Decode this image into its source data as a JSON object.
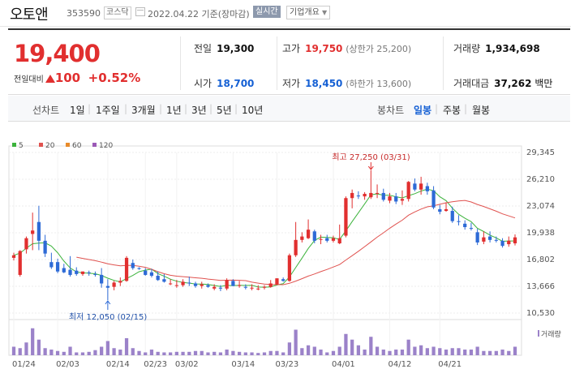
{
  "header": {
    "name": "오토앤",
    "code": "353590",
    "market": "코스닥",
    "date": "2022.04.22 기준(장마감)",
    "realtime": "실시간",
    "corp_overview": "기업개요"
  },
  "quote": {
    "price": "19,400",
    "change_label": "전일대비",
    "change": "100",
    "change_pct": "+0.52%",
    "rows": [
      {
        "label": "전일",
        "value": "19,300"
      },
      {
        "label": "고가",
        "value": "19,750",
        "sub": "(상한가 25,200)"
      },
      {
        "label": "거래량",
        "value": "1,934,698"
      },
      {
        "label": "시가",
        "value": "18,700"
      },
      {
        "label": "저가",
        "value": "18,450",
        "sub": "(하한가 13,600)"
      },
      {
        "label": "거래대금",
        "value": "37,262",
        "unit": "백만"
      }
    ]
  },
  "tabs": {
    "line_label": "선차트",
    "line_items": [
      "1일",
      "1주일",
      "3개월",
      "1년",
      "3년",
      "5년",
      "10년"
    ],
    "candle_label": "봉차트",
    "candle_items": [
      "일봉",
      "주봉",
      "월봉"
    ]
  },
  "chart_data": {
    "type": "candlestick",
    "legend": [
      "5",
      "20",
      "60",
      "120"
    ],
    "legend_colors": [
      "#3cb33c",
      "#e0524f",
      "#e88b2a",
      "#9b59b6"
    ],
    "y_ticks": [
      "29,345",
      "26,210",
      "23,074",
      "19,938",
      "16,802",
      "13,666",
      "10,530"
    ],
    "y_range": [
      10530,
      29345
    ],
    "x_labels": [
      "01/24",
      "02/03",
      "02/14",
      "02/23",
      "03/02",
      "03/14",
      "03/23",
      "04/01",
      "04/12",
      "04/21"
    ],
    "high_annotation": "최고 27,250 (03/31)",
    "low_annotation": "최저 12,050 (02/15)",
    "volume_label": "거래량",
    "candles": [
      {
        "o": 17000,
        "h": 17600,
        "l": 16700,
        "c": 17300
      },
      {
        "o": 15000,
        "h": 17900,
        "l": 14800,
        "c": 17800
      },
      {
        "o": 18000,
        "h": 19500,
        "l": 17500,
        "c": 19300
      },
      {
        "o": 19800,
        "h": 22300,
        "l": 17900,
        "c": 20200
      },
      {
        "o": 21200,
        "h": 23100,
        "l": 17900,
        "c": 19000
      },
      {
        "o": 19000,
        "h": 19700,
        "l": 17100,
        "c": 17500
      },
      {
        "o": 16500,
        "h": 17600,
        "l": 15700,
        "c": 15900
      },
      {
        "o": 16500,
        "h": 16900,
        "l": 15200,
        "c": 15400
      },
      {
        "o": 15800,
        "h": 16300,
        "l": 15200,
        "c": 15300
      },
      {
        "o": 15600,
        "h": 17200,
        "l": 14800,
        "c": 15000
      },
      {
        "o": 15500,
        "h": 15900,
        "l": 14900,
        "c": 15100
      },
      {
        "o": 15100,
        "h": 15400,
        "l": 14900,
        "c": 15400
      },
      {
        "o": 15300,
        "h": 15500,
        "l": 14900,
        "c": 15200
      },
      {
        "o": 15100,
        "h": 15400,
        "l": 14800,
        "c": 15000
      },
      {
        "o": 15000,
        "h": 15800,
        "l": 13500,
        "c": 14000
      },
      {
        "o": 13700,
        "h": 14500,
        "l": 12050,
        "c": 13500
      },
      {
        "o": 13600,
        "h": 14300,
        "l": 13200,
        "c": 14100
      },
      {
        "o": 14100,
        "h": 14700,
        "l": 13700,
        "c": 14300
      },
      {
        "o": 14300,
        "h": 17200,
        "l": 14200,
        "c": 17000
      },
      {
        "o": 16400,
        "h": 16800,
        "l": 15600,
        "c": 15800
      },
      {
        "o": 15800,
        "h": 15900,
        "l": 15600,
        "c": 15700
      },
      {
        "o": 15500,
        "h": 15800,
        "l": 14900,
        "c": 15000
      },
      {
        "o": 15300,
        "h": 15700,
        "l": 14700,
        "c": 14900
      },
      {
        "o": 14900,
        "h": 15400,
        "l": 14300,
        "c": 14400
      },
      {
        "o": 14500,
        "h": 15100,
        "l": 14100,
        "c": 14200
      },
      {
        "o": 14000,
        "h": 14500,
        "l": 13800,
        "c": 14000
      },
      {
        "o": 13800,
        "h": 14400,
        "l": 13500,
        "c": 13800
      },
      {
        "o": 13800,
        "h": 14500,
        "l": 13600,
        "c": 14200
      },
      {
        "o": 14100,
        "h": 14800,
        "l": 13700,
        "c": 14000
      },
      {
        "o": 14000,
        "h": 14200,
        "l": 13500,
        "c": 13700
      },
      {
        "o": 13700,
        "h": 14200,
        "l": 13400,
        "c": 13900
      },
      {
        "o": 13800,
        "h": 14000,
        "l": 13500,
        "c": 13600
      },
      {
        "o": 13400,
        "h": 13900,
        "l": 13200,
        "c": 13600
      },
      {
        "o": 13500,
        "h": 13800,
        "l": 13100,
        "c": 13400
      },
      {
        "o": 13400,
        "h": 14600,
        "l": 13200,
        "c": 14400
      },
      {
        "o": 14300,
        "h": 14500,
        "l": 13700,
        "c": 13700
      },
      {
        "o": 13800,
        "h": 14300,
        "l": 13500,
        "c": 13800
      },
      {
        "o": 13600,
        "h": 13900,
        "l": 13300,
        "c": 13500
      },
      {
        "o": 13500,
        "h": 13900,
        "l": 13200,
        "c": 13500
      },
      {
        "o": 13400,
        "h": 13800,
        "l": 13200,
        "c": 13400
      },
      {
        "o": 13500,
        "h": 13800,
        "l": 13300,
        "c": 13600
      },
      {
        "o": 13600,
        "h": 14400,
        "l": 13500,
        "c": 14000
      },
      {
        "o": 13900,
        "h": 14600,
        "l": 13800,
        "c": 14600
      },
      {
        "o": 14500,
        "h": 14700,
        "l": 14200,
        "c": 14300
      },
      {
        "o": 14300,
        "h": 17500,
        "l": 14200,
        "c": 17300
      },
      {
        "o": 17300,
        "h": 21200,
        "l": 17100,
        "c": 19100
      },
      {
        "o": 19100,
        "h": 20000,
        "l": 18800,
        "c": 19500
      },
      {
        "o": 19300,
        "h": 21500,
        "l": 19200,
        "c": 20300
      },
      {
        "o": 20100,
        "h": 20300,
        "l": 18700,
        "c": 19000
      },
      {
        "o": 19200,
        "h": 19700,
        "l": 18600,
        "c": 19200
      },
      {
        "o": 19300,
        "h": 19700,
        "l": 18800,
        "c": 19000
      },
      {
        "o": 19000,
        "h": 19600,
        "l": 18800,
        "c": 19300
      },
      {
        "o": 18700,
        "h": 20900,
        "l": 18600,
        "c": 19300
      },
      {
        "o": 19600,
        "h": 24200,
        "l": 19400,
        "c": 24000
      },
      {
        "o": 24000,
        "h": 25000,
        "l": 22800,
        "c": 24600
      },
      {
        "o": 24300,
        "h": 24800,
        "l": 23900,
        "c": 24200
      },
      {
        "o": 24200,
        "h": 24700,
        "l": 23800,
        "c": 24500
      },
      {
        "o": 24100,
        "h": 27250,
        "l": 23900,
        "c": 24600
      },
      {
        "o": 24600,
        "h": 25600,
        "l": 24000,
        "c": 24600
      },
      {
        "o": 24600,
        "h": 25100,
        "l": 23600,
        "c": 23800
      },
      {
        "o": 23700,
        "h": 24600,
        "l": 23400,
        "c": 24200
      },
      {
        "o": 24200,
        "h": 24600,
        "l": 23300,
        "c": 23600
      },
      {
        "o": 23700,
        "h": 24900,
        "l": 23200,
        "c": 23900
      },
      {
        "o": 23900,
        "h": 26000,
        "l": 23600,
        "c": 25900
      },
      {
        "o": 25700,
        "h": 26300,
        "l": 24800,
        "c": 25000
      },
      {
        "o": 25000,
        "h": 26500,
        "l": 24400,
        "c": 25700
      },
      {
        "o": 25400,
        "h": 25800,
        "l": 24400,
        "c": 24800
      },
      {
        "o": 24900,
        "h": 25400,
        "l": 22700,
        "c": 22900
      },
      {
        "o": 22700,
        "h": 23200,
        "l": 22100,
        "c": 22400
      },
      {
        "o": 22500,
        "h": 23500,
        "l": 22400,
        "c": 22700
      },
      {
        "o": 22500,
        "h": 23000,
        "l": 21100,
        "c": 21300
      },
      {
        "o": 21300,
        "h": 22000,
        "l": 20800,
        "c": 21200
      },
      {
        "o": 21000,
        "h": 21400,
        "l": 20300,
        "c": 20600
      },
      {
        "o": 20500,
        "h": 21100,
        "l": 20200,
        "c": 20400
      },
      {
        "o": 20000,
        "h": 20400,
        "l": 18500,
        "c": 18800
      },
      {
        "o": 18900,
        "h": 20100,
        "l": 18600,
        "c": 19400
      },
      {
        "o": 19500,
        "h": 20100,
        "l": 18800,
        "c": 19100
      },
      {
        "o": 19100,
        "h": 19500,
        "l": 18800,
        "c": 19000
      },
      {
        "o": 19000,
        "h": 19300,
        "l": 18200,
        "c": 18400
      },
      {
        "o": 18600,
        "h": 19500,
        "l": 18300,
        "c": 19000
      },
      {
        "o": 18700,
        "h": 19750,
        "l": 18450,
        "c": 19400
      }
    ],
    "volume": [
      0.3,
      0.25,
      0.45,
      0.95,
      0.55,
      0.25,
      0.2,
      0.15,
      0.12,
      0.3,
      0.1,
      0.1,
      0.12,
      0.18,
      0.3,
      0.5,
      0.25,
      0.2,
      0.6,
      0.25,
      0.15,
      0.1,
      0.2,
      0.12,
      0.1,
      0.1,
      0.12,
      0.12,
      0.12,
      0.15,
      0.15,
      0.1,
      0.12,
      0.1,
      0.2,
      0.15,
      0.12,
      0.1,
      0.1,
      0.08,
      0.1,
      0.15,
      0.15,
      0.1,
      0.45,
      0.9,
      0.25,
      0.35,
      0.3,
      0.2,
      0.1,
      0.15,
      0.3,
      0.75,
      0.55,
      0.35,
      0.2,
      0.65,
      0.3,
      0.2,
      0.15,
      0.2,
      0.2,
      0.55,
      0.3,
      0.35,
      0.25,
      0.3,
      0.25,
      0.2,
      0.25,
      0.25,
      0.2,
      0.2,
      0.3,
      0.15,
      0.15,
      0.15,
      0.2,
      0.15,
      0.3
    ]
  }
}
